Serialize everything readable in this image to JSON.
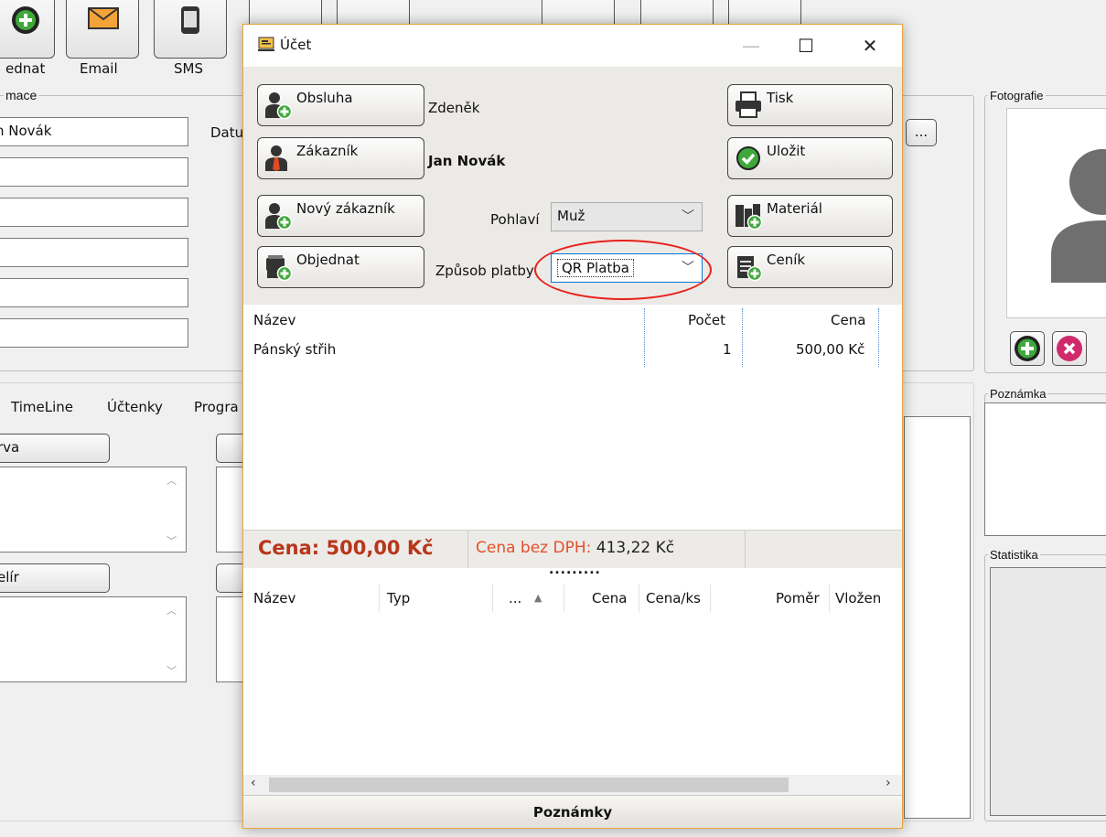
{
  "app": {
    "toolbar": [
      "ednat",
      "Email",
      "SMS"
    ],
    "info_group_title": "mace",
    "customer_name_value": "n Novák",
    "date_label": "Datu",
    "tabs": [
      "TimeLine",
      "Účtenky",
      "Progra"
    ],
    "btn_rva": "rva",
    "btn_elir": "elír",
    "photo_group_title": "Fotografie",
    "note_group_title": "Poznámka",
    "stats_group_title": "Statistika",
    "ellipsis_btn": "..."
  },
  "dialog": {
    "title": "Účet",
    "buttons": {
      "obsluha": "Obsluha",
      "zakaznik": "Zákazník",
      "novy_zakaznik": "Nový zákazník",
      "objednat": "Objednat",
      "tisk": "Tisk",
      "ulozit": "Uložit",
      "material": "Materiál",
      "cenik": "Ceník"
    },
    "staff_value": "Zdeněk",
    "customer_value": "Jan Novák",
    "gender_label": "Pohlaví",
    "gender_value": "Muž",
    "payment_label": "Způsob platby",
    "payment_value": "QR Platba",
    "items_table": {
      "columns": [
        "Název",
        "Počet",
        "Cena"
      ],
      "rows": [
        {
          "name": "Pánský střih",
          "count": "1",
          "price": "500,00 Kč"
        }
      ]
    },
    "price_label": "Cena:",
    "price_value": "500,00 Kč",
    "net_label": "Cena bez DPH:",
    "net_value": "413,22 Kč",
    "splitter_dots": ".........",
    "materials_table": {
      "columns": [
        "Název",
        "Typ",
        "...",
        "Cena",
        "Cena/ks",
        "Poměr",
        "Vložen"
      ]
    },
    "notes_label": "Poznámky"
  },
  "colors": {
    "price_red": "#b8361a",
    "net_orange": "#e5502a",
    "highlight_circle": "#e8221e",
    "window_border": "#e8a43c"
  }
}
